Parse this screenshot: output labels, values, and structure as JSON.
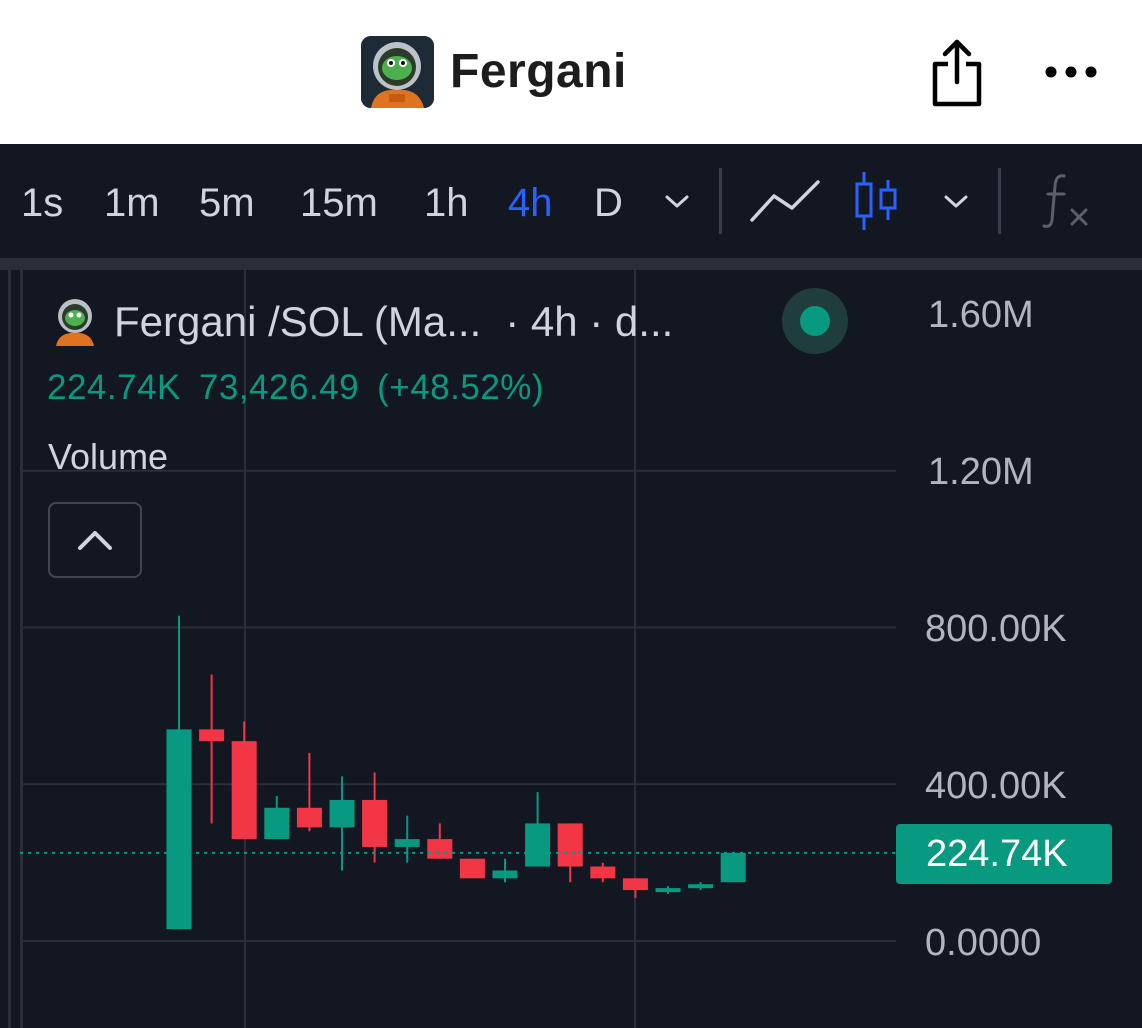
{
  "header": {
    "title": "Fergani",
    "share_icon": "share-icon",
    "more_icon": "more-icon"
  },
  "toolbar": {
    "timeframes": [
      "1s",
      "1m",
      "5m",
      "15m",
      "1h",
      "4h",
      "D"
    ],
    "active_timeframe": "4h",
    "icons": [
      "chevron-down-icon",
      "line-chart-icon",
      "candles-icon",
      "chevron-down-icon",
      "function-icon"
    ],
    "accent": "#2962ff"
  },
  "legend": {
    "symbol": "Fergani /SOL (Ma...",
    "interval": "· 4h · d...",
    "last": "224.74K",
    "change": "73,426.49",
    "change_pct": "(+48.52%)",
    "indicator": "Volume"
  },
  "colors": {
    "up": "#089981",
    "down": "#f23645",
    "background": "#131722"
  },
  "chart_data": {
    "type": "candlestick",
    "y_ticks": [
      "1.60M",
      "1.20M",
      "800.00K",
      "400.00K",
      "0.0000"
    ],
    "ylim": [
      0,
      1600000
    ],
    "last_price_label": "224.74K",
    "last_price": 224740,
    "candles": [
      {
        "o": 30000,
        "h": 830000,
        "l": 30000,
        "c": 540000
      },
      {
        "o": 540000,
        "h": 680000,
        "l": 300000,
        "c": 510000
      },
      {
        "o": 510000,
        "h": 560000,
        "l": 260000,
        "c": 260000
      },
      {
        "o": 260000,
        "h": 370000,
        "l": 260000,
        "c": 340000
      },
      {
        "o": 340000,
        "h": 480000,
        "l": 280000,
        "c": 290000
      },
      {
        "o": 290000,
        "h": 420000,
        "l": 180000,
        "c": 360000
      },
      {
        "o": 360000,
        "h": 430000,
        "l": 200000,
        "c": 240000
      },
      {
        "o": 240000,
        "h": 320000,
        "l": 200000,
        "c": 260000
      },
      {
        "o": 260000,
        "h": 300000,
        "l": 210000,
        "c": 210000
      },
      {
        "o": 210000,
        "h": 210000,
        "l": 170000,
        "c": 160000
      },
      {
        "o": 160000,
        "h": 210000,
        "l": 150000,
        "c": 180000
      },
      {
        "o": 190000,
        "h": 380000,
        "l": 190000,
        "c": 300000
      },
      {
        "o": 300000,
        "h": 300000,
        "l": 150000,
        "c": 190000
      },
      {
        "o": 190000,
        "h": 200000,
        "l": 150000,
        "c": 160000
      },
      {
        "o": 160000,
        "h": 160000,
        "l": 110000,
        "c": 130000
      },
      {
        "o": 130000,
        "h": 140000,
        "l": 120000,
        "c": 135000
      },
      {
        "o": 140000,
        "h": 150000,
        "l": 130000,
        "c": 145000
      },
      {
        "o": 150000,
        "h": 225000,
        "l": 150000,
        "c": 225000
      }
    ]
  }
}
